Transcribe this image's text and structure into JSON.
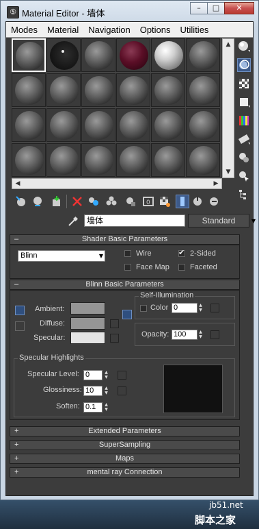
{
  "window": {
    "title": "Material Editor - 墙体"
  },
  "title_buttons": {
    "minimize": "–",
    "maximize": "□",
    "close": "✕"
  },
  "menu": [
    {
      "label": "Modes"
    },
    {
      "label": "Material"
    },
    {
      "label": "Navigation"
    },
    {
      "label": "Options"
    },
    {
      "label": "Utilities"
    }
  ],
  "slots": {
    "rows": 4,
    "cols": 6,
    "active_index": 0,
    "special": {
      "0": "grey",
      "1": "blackdot",
      "2": "grey",
      "3": "red",
      "4": "white",
      "5": "grey"
    }
  },
  "side_tools": [
    {
      "icon": "sample-type-sphere-icon"
    },
    {
      "icon": "backlight-icon",
      "active": true
    },
    {
      "icon": "background-checker-icon"
    },
    {
      "icon": "sample-uv-tiling-icon"
    },
    {
      "icon": "video-color-check-icon"
    },
    {
      "icon": "make-preview-icon"
    },
    {
      "icon": "options-icon"
    },
    {
      "icon": "select-by-material-icon"
    },
    {
      "icon": "material-map-navigator-icon"
    }
  ],
  "toolbar_icons": [
    "get-material-icon",
    "put-to-scene-icon",
    "assign-to-selection-icon",
    "reset-map-icon",
    "make-copy-icon",
    "make-unique-icon",
    "put-to-library-icon",
    "material-id-channel-icon",
    "show-map-in-viewport-icon",
    "show-end-result-icon",
    "go-to-parent-icon",
    "go-forward-to-sibling-icon"
  ],
  "material": {
    "name": "墙体",
    "type_button": "Standard"
  },
  "shader_basic": {
    "title": "Shader Basic Parameters",
    "shader": "Blinn",
    "wire": "Wire",
    "two_sided": "2-Sided",
    "face_map": "Face Map",
    "faceted": "Faceted",
    "two_sided_checked": true
  },
  "blinn_basic": {
    "title": "Blinn Basic Parameters",
    "ambient": "Ambient:",
    "diffuse": "Diffuse:",
    "specular": "Specular:",
    "self_illum_title": "Self-Illumination",
    "color_label": "Color",
    "color_value": "0",
    "opacity_label": "Opacity:",
    "opacity_value": "100",
    "colors": {
      "ambient": "#959595",
      "diffuse": "#959595",
      "specular": "#e5e5e5"
    }
  },
  "specular_highlights": {
    "title": "Specular Highlights",
    "level_label": "Specular Level:",
    "level_value": "0",
    "gloss_label": "Glossiness:",
    "gloss_value": "10",
    "soften_label": "Soften:",
    "soften_value": "0.1"
  },
  "collapsed_rollouts": [
    {
      "label": "Extended Parameters"
    },
    {
      "label": "SuperSampling"
    },
    {
      "label": "Maps"
    },
    {
      "label": "mental ray Connection"
    }
  ],
  "symbols": {
    "minus": "–",
    "plus": "+",
    "check": "✔"
  },
  "watermark": {
    "line1": "jb51.net",
    "line2": "脚本之家"
  }
}
